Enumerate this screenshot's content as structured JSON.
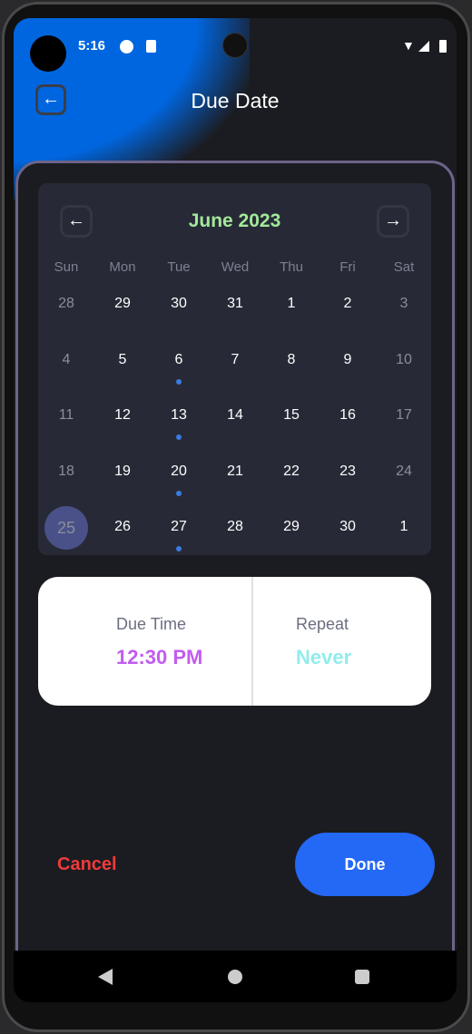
{
  "status": {
    "time": "5:16"
  },
  "header": {
    "title": "Due Date",
    "back_icon": "arrow-left-icon"
  },
  "calendar": {
    "month_label": "June 2023",
    "weekdays": [
      "Sun",
      "Mon",
      "Tue",
      "Wed",
      "Thu",
      "Fri",
      "Sat"
    ],
    "weeks": [
      [
        "28",
        "29",
        "30",
        "31",
        "1",
        "2",
        "3"
      ],
      [
        "4",
        "5",
        "6",
        "7",
        "8",
        "9",
        "10"
      ],
      [
        "11",
        "12",
        "13",
        "14",
        "15",
        "16",
        "17"
      ],
      [
        "18",
        "19",
        "20",
        "21",
        "22",
        "23",
        "24"
      ],
      [
        "25",
        "26",
        "27",
        "28",
        "29",
        "30",
        "1"
      ]
    ],
    "selected": "25",
    "event_days": [
      "6",
      "13",
      "20",
      "27"
    ]
  },
  "due_time": {
    "label": "Due Time",
    "value": "12:30 PM"
  },
  "repeat": {
    "label": "Repeat",
    "value": "Never"
  },
  "actions": {
    "cancel": "Cancel",
    "done": "Done"
  },
  "colors": {
    "month": "#a3e89a",
    "time": "#c25cf0",
    "repeat": "#92ecec",
    "cancel": "#ef3b3b",
    "done": "#2468f6"
  }
}
